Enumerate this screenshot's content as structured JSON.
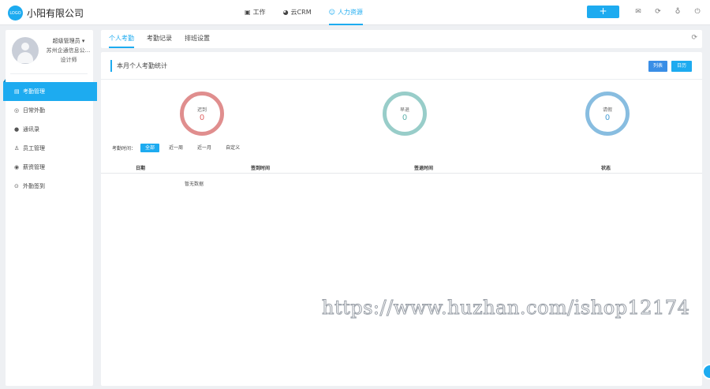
{
  "app": {
    "logo_text": "LOGO",
    "title": "小阳有限公司"
  },
  "topnav": [
    {
      "icon": "briefcase-icon",
      "label": "工作"
    },
    {
      "icon": "crm-icon",
      "label": "云CRM"
    },
    {
      "icon": "users-icon",
      "label": "人力资源",
      "active": true
    }
  ],
  "toolbar": {
    "add_label": "+",
    "icons": [
      "mail-icon",
      "sync-icon",
      "bulb-icon",
      "power-icon"
    ]
  },
  "user": {
    "role": "超级管理员 ▾",
    "company": "苏州企通信息公...",
    "title": "设计师"
  },
  "sidebar": {
    "items": [
      {
        "icon": "attendance-icon",
        "label": "考勤管理",
        "active": true
      },
      {
        "icon": "location-icon",
        "label": "日常外勤"
      },
      {
        "icon": "contacts-icon",
        "label": "通讯录"
      },
      {
        "icon": "staff-icon",
        "label": "员工管理"
      },
      {
        "icon": "salary-icon",
        "label": "薪资管理"
      },
      {
        "icon": "pin-icon",
        "label": "外勤签到"
      }
    ]
  },
  "tabs": [
    {
      "label": "个人考勤",
      "active": true
    },
    {
      "label": "考勤记录"
    },
    {
      "label": "排班设置"
    }
  ],
  "main": {
    "section_title": "本月个人考勤统计",
    "view_list": "列表",
    "view_calendar": "日历",
    "stats": [
      {
        "label": "迟到",
        "value": "0",
        "color": "#e08e8e",
        "text_color": "#e06666"
      },
      {
        "label": "早退",
        "value": "0",
        "color": "#98cdc9",
        "text_color": "#5fb3ad"
      },
      {
        "label": "请假",
        "value": "0",
        "color": "#88bde0",
        "text_color": "#4a9fd6"
      }
    ],
    "filter": {
      "label": "考勤时间：",
      "options": [
        {
          "label": "全部",
          "active": true
        },
        {
          "label": "近一周"
        },
        {
          "label": "近一月"
        },
        {
          "label": "自定义"
        }
      ]
    },
    "table": {
      "columns": [
        "日期",
        "签到时间",
        "签退时间",
        "状态"
      ],
      "empty_text": "暂无数据"
    }
  },
  "watermark": "https://www.huzhan.com/ishop12174",
  "colors": {
    "accent": "#1dabf0",
    "list_button": "#3a8ee6",
    "calendar_button": "#1dabf0"
  }
}
